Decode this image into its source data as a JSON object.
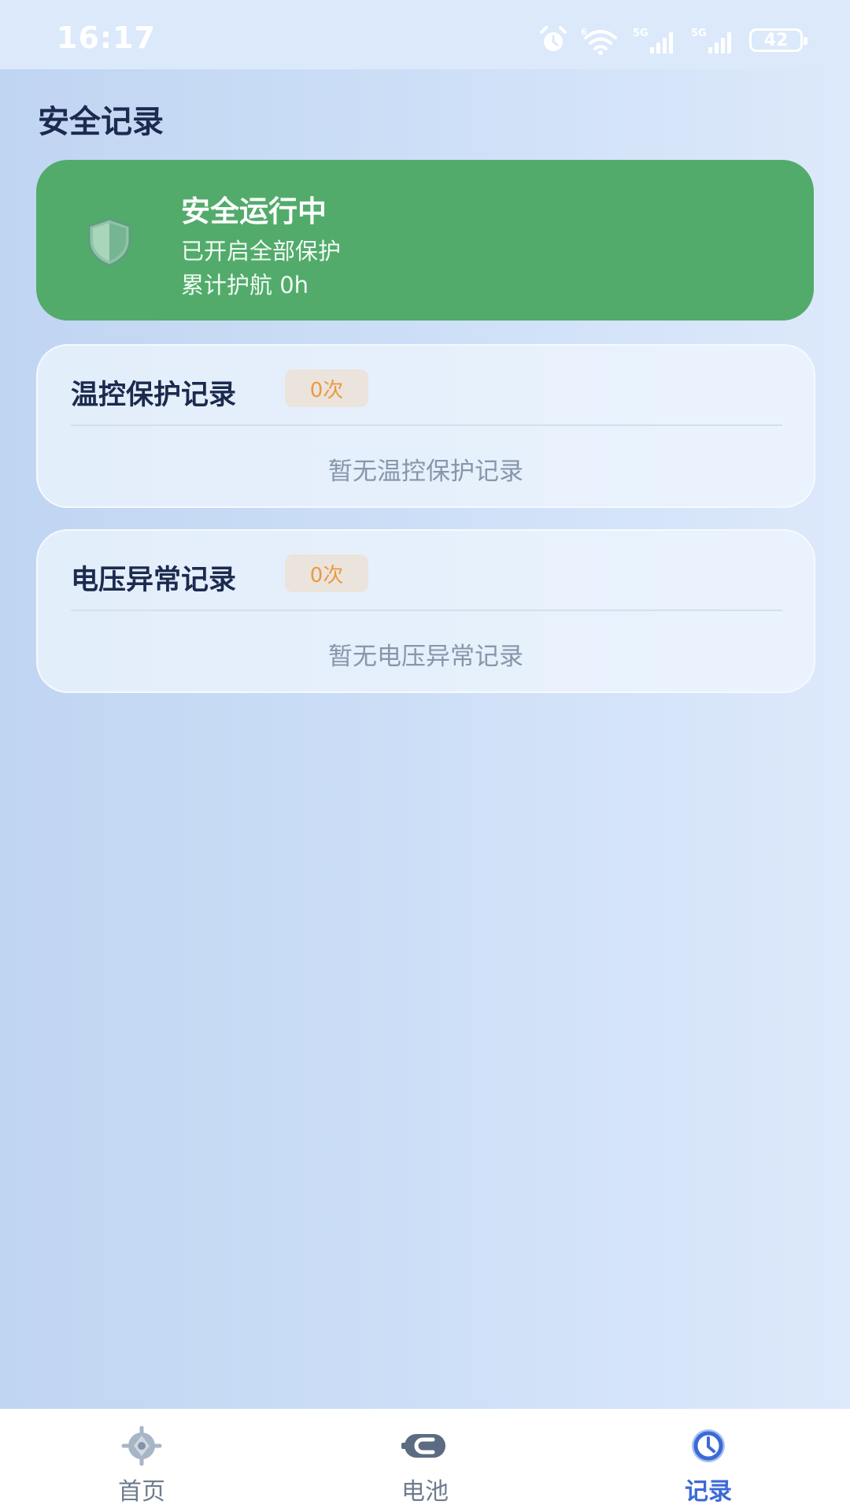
{
  "status_bar": {
    "time": "16:17",
    "battery": "42"
  },
  "page": {
    "title": "安全记录"
  },
  "safety_status": {
    "title": "安全运行中",
    "line1": "已开启全部保护",
    "line2": "累计护航 0h",
    "color": "#52ab6b"
  },
  "records": [
    {
      "title": "温控保护记录",
      "count": "0次",
      "empty_text": "暂无温控保护记录"
    },
    {
      "title": "电压异常记录",
      "count": "0次",
      "empty_text": "暂无电压异常记录"
    }
  ],
  "tabbar": {
    "items": [
      {
        "label": "首页",
        "icon": "home-icon",
        "active": false
      },
      {
        "label": "电池",
        "icon": "battery-plug-icon",
        "active": false
      },
      {
        "label": "记录",
        "icon": "clock-icon",
        "active": true
      }
    ],
    "active_color": "#3c6ad6",
    "inactive_color": "#6f7c8e"
  }
}
